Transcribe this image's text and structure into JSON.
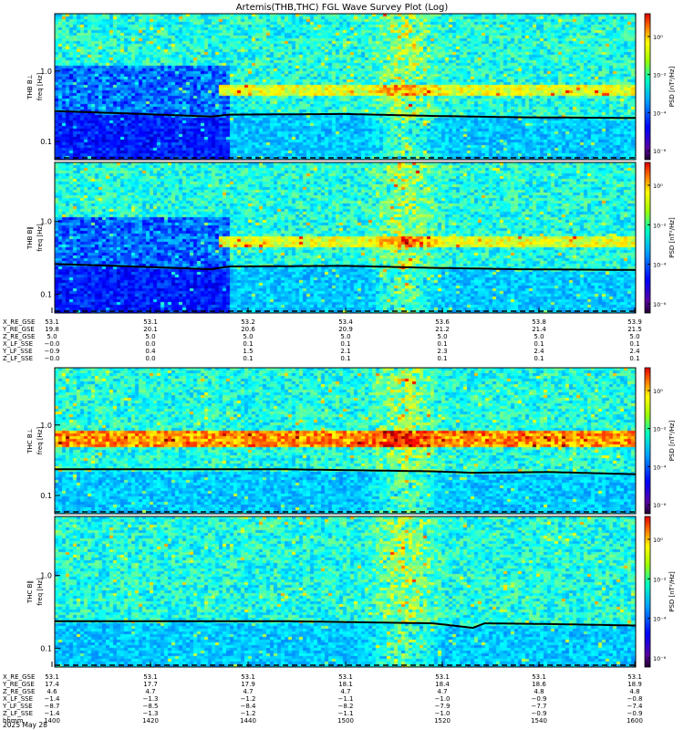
{
  "title": "Artemis(THB,THC) FGL Wave Survey Plot (Log)",
  "colors": {
    "background": "#ffffff",
    "trace": "#000000"
  },
  "chart_data": {
    "type": "heatmap",
    "colorscale": "jet",
    "yscale": "log",
    "panels": [
      {
        "name": "THB B⊥",
        "ylabel": "THB B⊥",
        "freq_label": "freq [Hz]",
        "ylim": [
          0.055,
          6.5
        ],
        "yticks": [
          "1.0",
          "0.1"
        ],
        "cbar_label": "PSD [nT²/Hz]",
        "cbar_ticks": [
          "10⁰",
          "10⁻²",
          "10⁻⁴",
          "10⁻⁶"
        ],
        "dark_frac": 0.3,
        "fc_profile": [
          [
            0.0,
            0.27
          ],
          [
            0.27,
            0.225
          ],
          [
            0.3,
            0.24
          ],
          [
            0.5,
            0.245
          ],
          [
            0.65,
            0.23
          ],
          [
            0.8,
            0.22
          ],
          [
            1.0,
            0.215
          ]
        ]
      },
      {
        "name": "THB B∥",
        "ylabel": "THB B∥",
        "freq_label": "freq [Hz]",
        "ylim": [
          0.055,
          6.5
        ],
        "yticks": [
          "1.0",
          "0.1"
        ],
        "cbar_label": "PSD [nT²/Hz]",
        "cbar_ticks": [
          "10⁰",
          "10⁻²",
          "10⁻⁴",
          "10⁻⁶"
        ],
        "dark_frac": 0.3,
        "fc_profile": [
          [
            0.0,
            0.26
          ],
          [
            0.27,
            0.22
          ],
          [
            0.3,
            0.24
          ],
          [
            0.5,
            0.245
          ],
          [
            0.65,
            0.23
          ],
          [
            0.8,
            0.22
          ],
          [
            1.0,
            0.215
          ]
        ]
      },
      {
        "name": "THC B⊥",
        "ylabel": "THC B⊥",
        "freq_label": "freq [Hz]",
        "ylim": [
          0.055,
          6.5
        ],
        "yticks": [
          "1.0",
          "0.1"
        ],
        "cbar_label": "PSD [nT²/Hz]",
        "cbar_ticks": [
          "10⁰",
          "10⁻²",
          "10⁻⁴",
          "10⁻⁶"
        ],
        "dark_frac": 0.0,
        "fc_profile": [
          [
            0.0,
            0.235
          ],
          [
            0.4,
            0.235
          ],
          [
            0.65,
            0.22
          ],
          [
            0.72,
            0.21
          ],
          [
            0.85,
            0.215
          ],
          [
            1.0,
            0.2
          ]
        ]
      },
      {
        "name": "THC B∥",
        "ylabel": "THC B∥",
        "freq_label": "freq [Hz]",
        "ylim": [
          0.055,
          6.5
        ],
        "yticks": [
          "1.0",
          "0.1"
        ],
        "cbar_label": "PSD [nT²/Hz]",
        "cbar_ticks": [
          "10⁰",
          "10⁻²",
          "10⁻⁴",
          "10⁻⁶"
        ],
        "dark_frac": 0.0,
        "fc_profile": [
          [
            0.0,
            0.235
          ],
          [
            0.4,
            0.235
          ],
          [
            0.65,
            0.22
          ],
          [
            0.72,
            0.19
          ],
          [
            0.74,
            0.22
          ],
          [
            0.85,
            0.215
          ],
          [
            1.0,
            0.205
          ]
        ]
      }
    ],
    "ephemeris_tables": [
      {
        "rows": [
          {
            "label": "X_RE_GSE",
            "values": [
              "53.1",
              "53.1",
              "53.2",
              "53.4",
              "53.6",
              "53.8",
              "53.9"
            ]
          },
          {
            "label": "Y_RE_GSE",
            "values": [
              "19.8",
              "20.1",
              "20.6",
              "20.9",
              "21.2",
              "21.4",
              "21.5"
            ]
          },
          {
            "label": "Z_RE_GSE",
            "values": [
              "5.0",
              "5.0",
              "5.0",
              "5.0",
              "5.0",
              "5.0",
              "5.0"
            ]
          },
          {
            "label": "X_LF_SSE",
            "values": [
              "−0.0",
              "0.0",
              "0.1",
              "0.1",
              "0.1",
              "0.1",
              "0.1"
            ]
          },
          {
            "label": "Y_LF_SSE",
            "values": [
              "−0.9",
              "0.4",
              "1.5",
              "2.1",
              "2.3",
              "2.4",
              "2.4"
            ]
          },
          {
            "label": "Z_LF_SSE",
            "values": [
              "−0.0",
              "0.0",
              "0.1",
              "0.1",
              "0.1",
              "0.1",
              "0.1"
            ]
          }
        ]
      },
      {
        "rows": [
          {
            "label": "X_RE_GSE",
            "values": [
              "53.1",
              "53.1",
              "53.1",
              "53.1",
              "53.1",
              "53.1",
              "53.1"
            ]
          },
          {
            "label": "Y_RE_GSE",
            "values": [
              "17.4",
              "17.7",
              "17.9",
              "18.1",
              "18.4",
              "18.6",
              "18.9"
            ]
          },
          {
            "label": "Z_RE_GSE",
            "values": [
              "4.6",
              "4.7",
              "4.7",
              "4.7",
              "4.7",
              "4.8",
              "4.8"
            ]
          },
          {
            "label": "X_LF_SSE",
            "values": [
              "−1.4",
              "−1.3",
              "−1.2",
              "−1.1",
              "−1.0",
              "−0.9",
              "−0.8"
            ]
          },
          {
            "label": "Y_LF_SSE",
            "values": [
              "−8.7",
              "−8.5",
              "−8.4",
              "−8.2",
              "−7.9",
              "−7.7",
              "−7.4"
            ]
          },
          {
            "label": "Z_LF_SSE",
            "values": [
              "−1.4",
              "−1.3",
              "−1.2",
              "−1.1",
              "−1.0",
              "−0.9",
              "−0.9"
            ]
          },
          {
            "label": "hhmm",
            "values": [
              "1400",
              "1420",
              "1440",
              "1500",
              "1520",
              "1540",
              "1600"
            ]
          }
        ]
      }
    ],
    "date_label": "2025 May 28"
  }
}
